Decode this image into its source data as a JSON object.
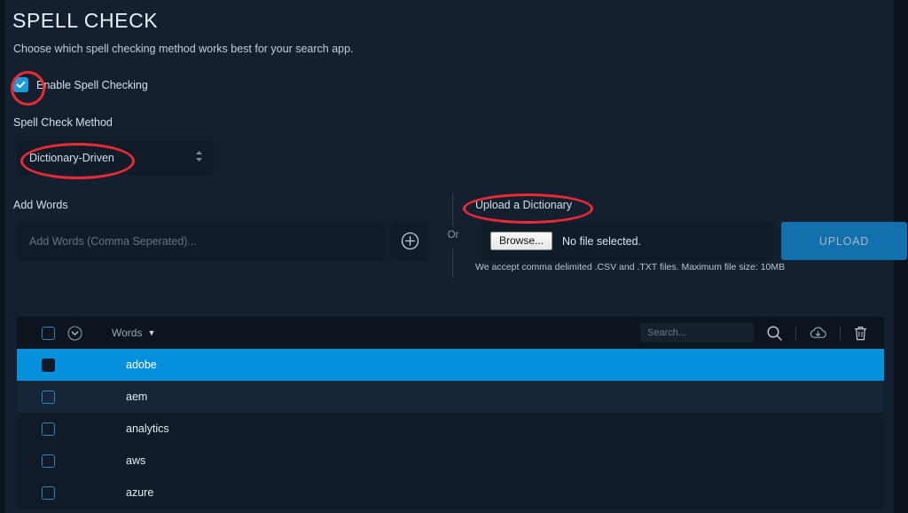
{
  "page": {
    "title": "SPELL CHECK",
    "subtitle": "Choose which spell checking method works best for your search app."
  },
  "enable": {
    "label": "Enable Spell Checking",
    "checked": true
  },
  "method": {
    "label": "Spell Check Method",
    "value": "Dictionary-Driven",
    "options": [
      "Dictionary-Driven"
    ]
  },
  "add_words": {
    "label": "Add Words",
    "placeholder": "Add Words (Comma Seperated)...",
    "value": "",
    "add_button_icon": "plus-circle-icon"
  },
  "separator": {
    "text": "Or"
  },
  "upload": {
    "label": "Upload a Dictionary",
    "browse_label": "Browse...",
    "file_status": "No file selected.",
    "button_label": "UPLOAD",
    "help_text": "We accept comma delimited .CSV and .TXT files. Maximum file size: 10MB"
  },
  "table": {
    "header": {
      "column_label": "Words",
      "sort_direction": "desc",
      "search_placeholder": "Search...",
      "search_value": "",
      "icons": [
        "search-icon",
        "cloud-download-icon",
        "trash-icon"
      ]
    },
    "rows": [
      {
        "word": "adobe",
        "selected": true
      },
      {
        "word": "aem",
        "selected": false
      },
      {
        "word": "analytics",
        "selected": false
      },
      {
        "word": "aws",
        "selected": false
      },
      {
        "word": "azure",
        "selected": false
      }
    ]
  },
  "colors": {
    "accent": "#0490dd",
    "checkbox_on": "#1d9bd9",
    "upload_button": "#1270ad",
    "annotation": "#ee2b34",
    "page_bg": "#14202f",
    "table_header_bg": "#0c141e"
  },
  "annotations": [
    {
      "name": "enable-checkbox-highlight",
      "shape": "ellipse"
    },
    {
      "name": "method-select-highlight",
      "shape": "ellipse"
    },
    {
      "name": "upload-dictionary-highlight",
      "shape": "ellipse"
    }
  ]
}
